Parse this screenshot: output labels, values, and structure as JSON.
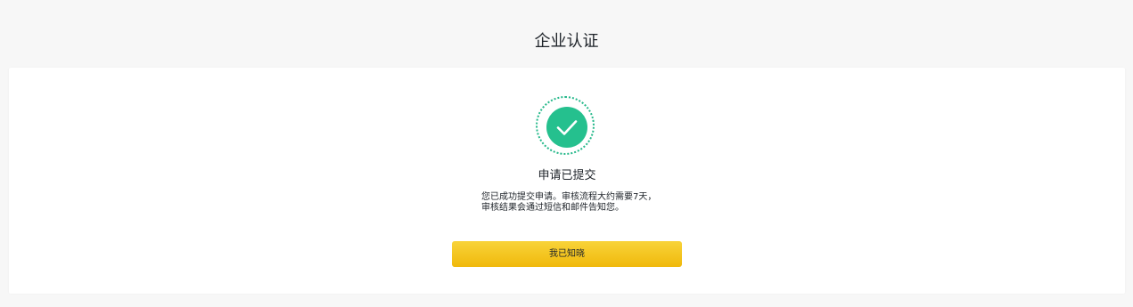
{
  "header": {
    "title": "企业认证"
  },
  "result": {
    "icon": "check-circle-icon",
    "title": "申请已提交",
    "description": "您已成功提交申请。审核流程大约需要7天，审核结果会通过短信和邮件告知您。"
  },
  "actions": {
    "confirm_label": "我已知晓"
  },
  "colors": {
    "success": "#25c08e",
    "primary_button": "#f0b90b",
    "background": "#f7f7f7",
    "card": "#ffffff"
  }
}
